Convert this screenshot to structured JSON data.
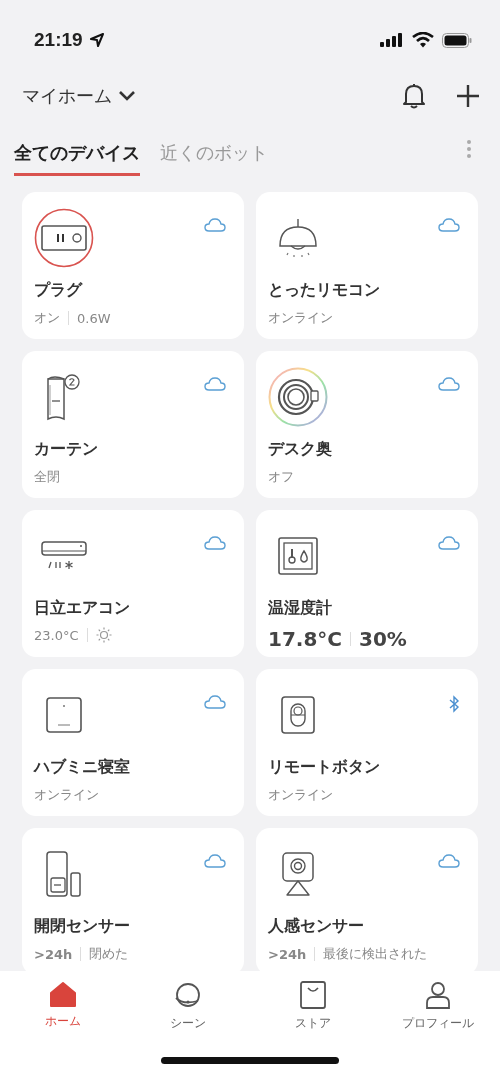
{
  "status_bar": {
    "time": "21:19"
  },
  "header": {
    "home": "マイホーム"
  },
  "tabs": [
    {
      "label": "全てのデバイス",
      "selected": true
    },
    {
      "label": "近くのボット",
      "selected": false
    }
  ],
  "devices": [
    {
      "name": "プラグ",
      "kind": "plug",
      "status": [
        {
          "kind": "text",
          "text": "オン"
        },
        {
          "kind": "text",
          "text": "0.6W"
        }
      ]
    },
    {
      "name": "とったリモコン",
      "kind": "lamp",
      "status": [
        {
          "kind": "text",
          "text": "オンライン"
        }
      ]
    },
    {
      "name": "カーテン",
      "kind": "curtain",
      "status": [
        {
          "kind": "text",
          "text": "全閉"
        }
      ]
    },
    {
      "name": "デスク奥",
      "kind": "light",
      "status": [
        {
          "kind": "text",
          "text": "オフ"
        }
      ]
    },
    {
      "name": "日立エアコン",
      "kind": "aircon",
      "status": [
        {
          "kind": "text",
          "text": "23.0°C"
        },
        {
          "kind": "sun"
        }
      ]
    },
    {
      "name": "温湿度計",
      "kind": "meter",
      "status": [
        {
          "kind": "large",
          "text": "17.8°C"
        },
        {
          "kind": "large",
          "text": "30%"
        }
      ]
    },
    {
      "name": "ハブミニ寝室",
      "kind": "hub",
      "status": [
        {
          "kind": "text",
          "text": "オンライン"
        }
      ]
    },
    {
      "name": "リモートボタン",
      "kind": "button",
      "status": [
        {
          "kind": "text",
          "text": "オンライン"
        }
      ]
    },
    {
      "name": "開閉センサー",
      "kind": "contact",
      "status": [
        {
          "kind": "bold",
          "text": ">24h"
        },
        {
          "kind": "text",
          "text": "閉めた"
        }
      ]
    },
    {
      "name": "人感センサー",
      "kind": "motion",
      "status": [
        {
          "kind": "bold",
          "text": ">24h"
        },
        {
          "kind": "text",
          "text": "最後に検出された"
        }
      ]
    }
  ],
  "nav": [
    {
      "label": "ホーム",
      "kind": "home",
      "selected": true
    },
    {
      "label": "シーン",
      "kind": "scene",
      "selected": false
    },
    {
      "label": "ストア",
      "kind": "store",
      "selected": false
    },
    {
      "label": "プロフィール",
      "kind": "profile",
      "selected": false
    }
  ]
}
